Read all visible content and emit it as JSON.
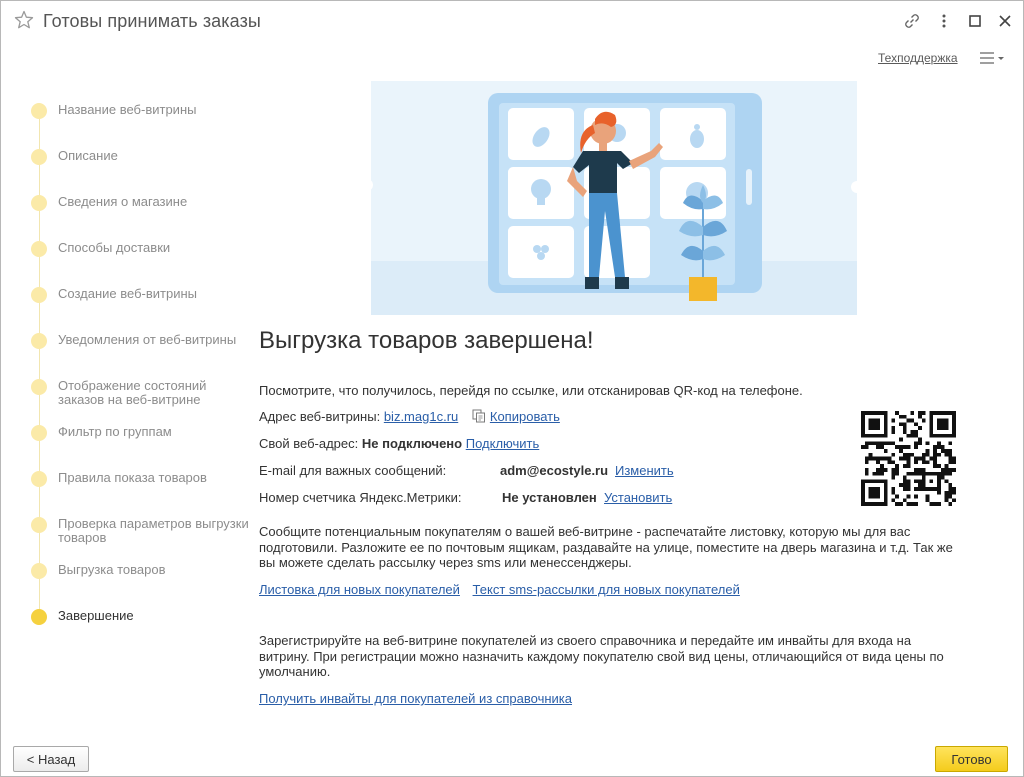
{
  "window": {
    "title": "Готовы принимать заказы",
    "support_link": "Техподдержка"
  },
  "steps": [
    {
      "label": "Название веб-витрины",
      "active": false
    },
    {
      "label": "Описание",
      "active": false
    },
    {
      "label": "Сведения о магазине",
      "active": false
    },
    {
      "label": "Способы доставки",
      "active": false
    },
    {
      "label": "Создание веб-витрины",
      "active": false
    },
    {
      "label": "Уведомления от веб-витрины",
      "active": false
    },
    {
      "label": "Отображение состояний заказов на веб-витрине",
      "active": false
    },
    {
      "label": "Фильтр по группам",
      "active": false
    },
    {
      "label": "Правила показа товаров",
      "active": false
    },
    {
      "label": "Проверка параметров выгрузки товаров",
      "active": false
    },
    {
      "label": "Выгрузка товаров",
      "active": false
    },
    {
      "label": "Завершение",
      "active": true
    }
  ],
  "main": {
    "heading": "Выгрузка товаров завершена!",
    "intro": "Посмотрите, что получилось, перейдя по ссылке, или отсканировав QR-код на телефоне.",
    "address_label": "Адрес веб-витрины:",
    "address_link": "biz.mag1c.ru",
    "copy_label": "Копировать",
    "own_address_label": "Свой веб-адрес:",
    "own_address_value": "Не подключено",
    "own_address_action": "Подключить",
    "email_label": "E-mail для важных сообщений:",
    "email_value": "adm@ecostyle.ru",
    "email_action": "Изменить",
    "metrika_label": "Номер счетчика Яндекс.Метрики:",
    "metrika_value": "Не установлен",
    "metrika_action": "Установить",
    "promo_text": "Сообщите потенциальным покупателям о вашей веб-витрине - распечатайте листовку, которую мы для вас подготовили. Разложите ее по почтовым ящикам, раздавайте на улице, поместите на дверь магазина и т.д. Так же вы можете сделать рассылку через sms или менессенджеры.",
    "flyer_link": "Листовка для новых покупателей",
    "sms_link": "Текст sms-рассылки для новых покупателей",
    "register_text": "Зарегистрируйте на веб-витрине покупателей из своего справочника и передайте им инвайты для входа на витрину. При регистрации можно назначить каждому покупателю свой вид цены, отличающийся от вида цены по умолчанию.",
    "invites_link": "Получить инвайты для покупателей из справочника"
  },
  "buttons": {
    "back": "< Назад",
    "done": "Готово"
  },
  "colors": {
    "accent_yellow": "#f5d13f",
    "step_dot": "#fbeaa8",
    "link_blue": "#2a5ea8",
    "hero_bg": "#eaf4fb"
  },
  "icons": [
    "star-icon",
    "link-icon",
    "more-vertical-icon",
    "maximize-icon",
    "close-icon",
    "hamburger-menu-icon",
    "copy-icon",
    "qr-code-icon"
  ]
}
